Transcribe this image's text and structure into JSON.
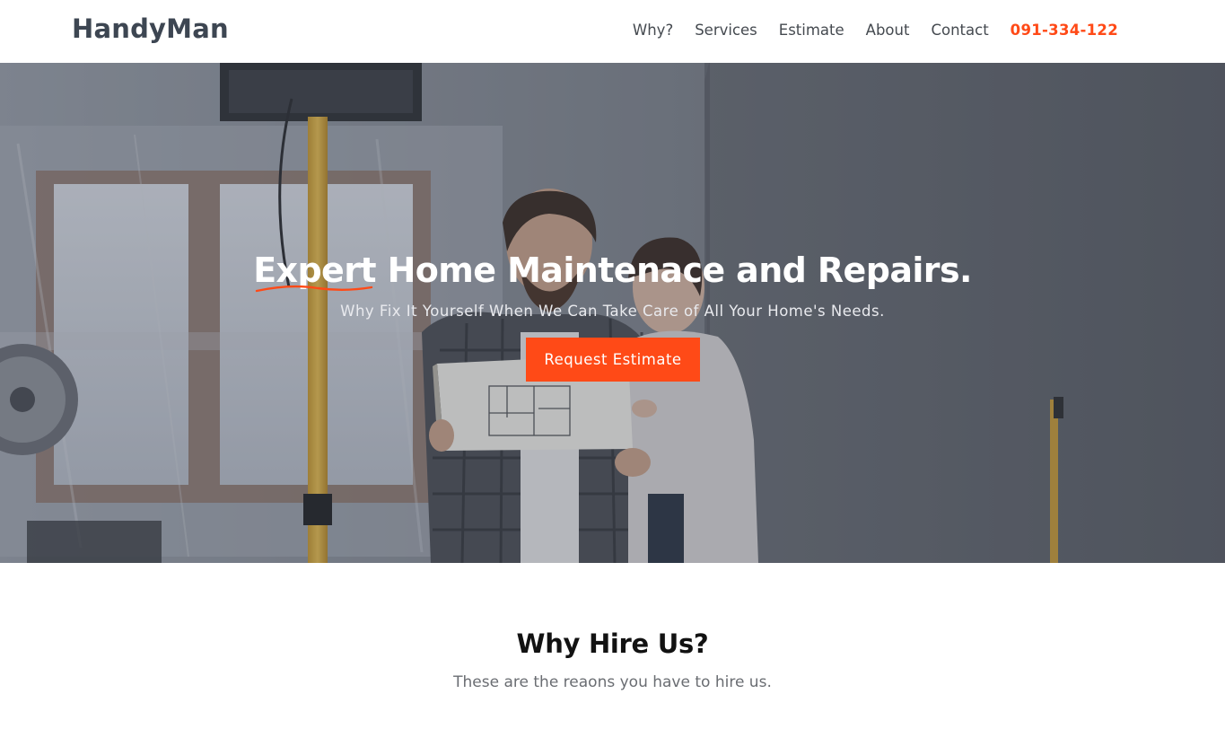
{
  "header": {
    "logo": "HandyMan",
    "nav": [
      {
        "label": "Why?"
      },
      {
        "label": "Services"
      },
      {
        "label": "Estimate"
      },
      {
        "label": "About"
      },
      {
        "label": "Contact"
      }
    ],
    "phone": "091-334-122"
  },
  "hero": {
    "title_accent": "Expert",
    "title_rest": " Home Maintenace and Repairs.",
    "subtitle": "Why Fix It Yourself When We Can Take Care of All Your Home's Needs.",
    "cta_label": "Request Estimate",
    "background_icon": "hero-photo-two-people-reviewing-floor-plan"
  },
  "why": {
    "title": "Why Hire Us?",
    "subtitle": "These are the reaons you have to hire us."
  },
  "colors": {
    "accent": "#ff4a17",
    "logo": "#3d4652",
    "nav_text": "#454a50",
    "hero_overlay": "#343946"
  }
}
